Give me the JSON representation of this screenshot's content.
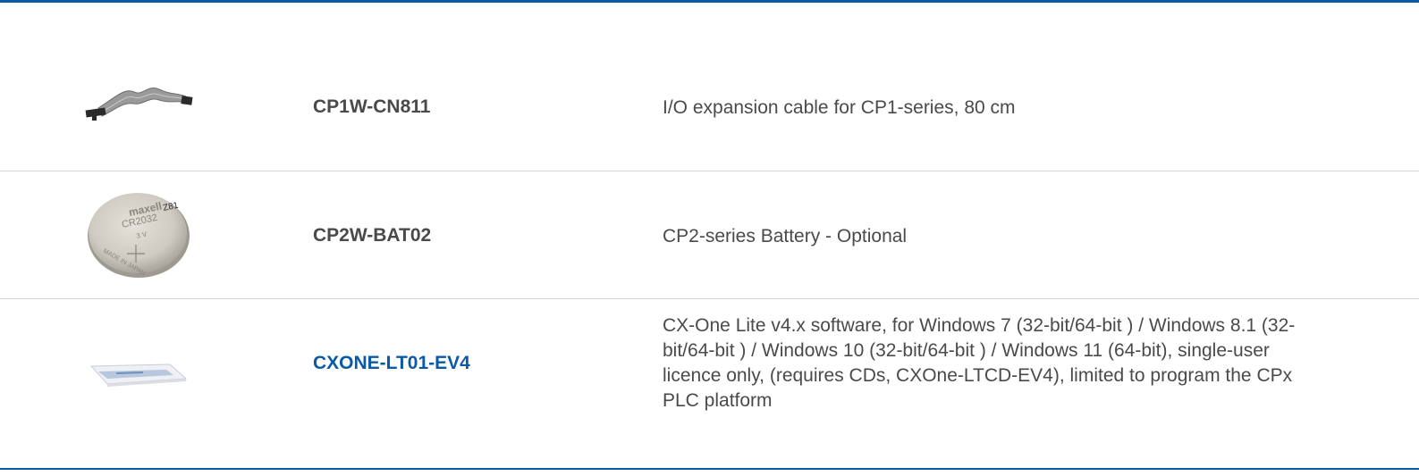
{
  "products": [
    {
      "code": "CP1W-CN811",
      "description": "I/O expansion cable for CP1-series, 80 cm",
      "image_icon": "ribbon-cable-image",
      "is_link": false
    },
    {
      "code": "CP2W-BAT02",
      "description": "CP2-series Battery - Optional",
      "image_icon": "coin-battery-image",
      "is_link": false,
      "battery_text": {
        "brand": "maxell",
        "model": "CR2032",
        "voltage": "3 V",
        "origin": "MADE IN JAPAN",
        "mark": "Z81"
      }
    },
    {
      "code": "CXONE-LT01-EV4",
      "description": "CX-One Lite v4.x software, for Windows 7 (32-bit/64-bit ) / Windows 8.1 (32-bit/64-bit ) / Windows 10 (32-bit/64-bit ) / Windows 11 (64-bit), single-user licence only, (requires CDs, CXOne-LTCD-EV4), limited to program the CPx PLC platform",
      "image_icon": "software-license-envelope-image",
      "is_link": true
    }
  ],
  "colors": {
    "accent": "#0b5aa8",
    "text": "#4a4a4a",
    "divider": "#d5d5d5"
  }
}
